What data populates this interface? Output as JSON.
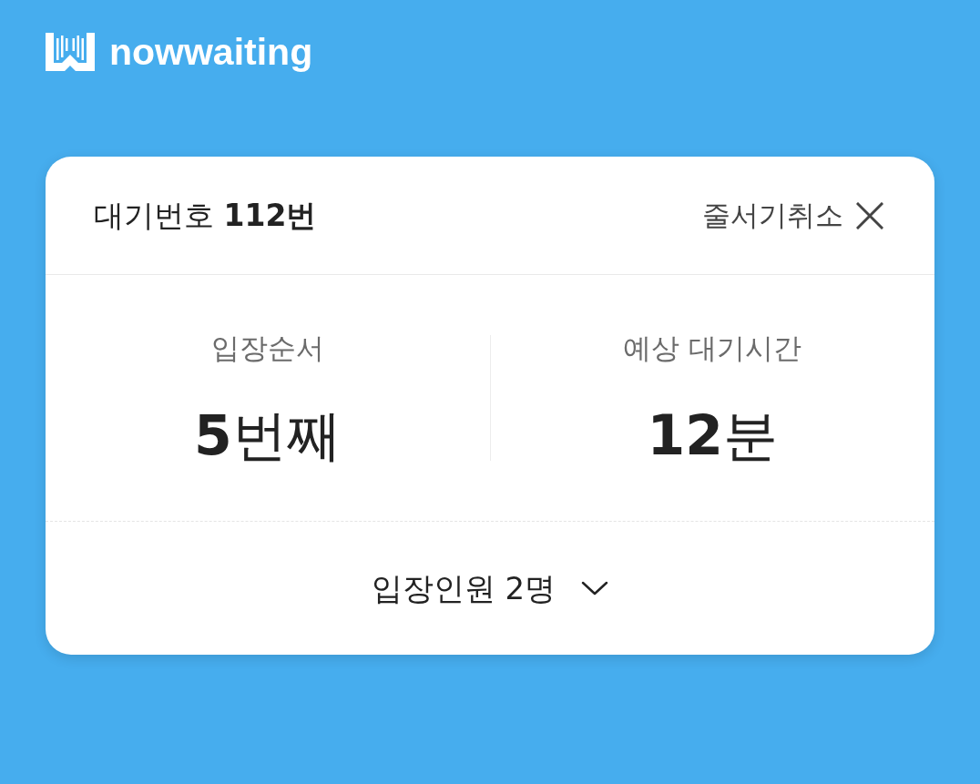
{
  "logo": {
    "text": "nowwaiting"
  },
  "ticket": {
    "title": "대기번호 **112번**",
    "cancel_button": "줄서기취소"
  },
  "stats": [
    {
      "label": "입장순서",
      "value": "**5**번째"
    },
    {
      "label": "예상 대기시간",
      "value": "**12**분"
    }
  ],
  "party": {
    "label": "입장인원 2명",
    "expanded": false
  }
}
